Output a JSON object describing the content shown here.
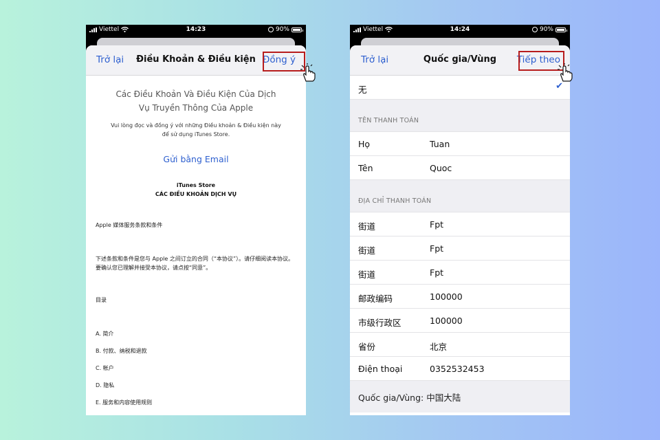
{
  "left_screen": {
    "status": {
      "carrier": "Viettel",
      "time": "14:23",
      "battery": "90%"
    },
    "nav": {
      "back": "Trở lại",
      "title": "Điều Khoản & Điều kiện",
      "action": "Đồng ý"
    },
    "terms_title": "Các Điều Khoản Và Điều Kiện Của Dịch Vụ Truyền Thông Của Apple",
    "terms_subtitle": "Vui lòng đọc và đồng ý với những Điều khoản & Điều kiện này để sử dụng iTunes Store.",
    "email_link": "Gửi bằng Email",
    "store_name": "iTunes Store",
    "store_heading": "CÁC ĐIỀU KHOẢN DỊCH VỤ",
    "paragraphs": [
      "Apple 媒体服务条款和条件",
      "下述条款和条件是您与 Apple 之间订立的合同（“本协议”）。请仔细阅读本协议。要确认您已理解并接受本协议，请点按“同意”。",
      "目录",
      "A. 简介",
      "B. 付款、纳税和退款",
      "C. 帐户",
      "D. 隐私",
      "E. 服务和内容使用规则"
    ]
  },
  "right_screen": {
    "status": {
      "carrier": "Viettel",
      "time": "14:24",
      "battery": "90%"
    },
    "nav": {
      "back": "Trở lại",
      "title": "Quốc gia/Vùng",
      "action": "Tiếp theo"
    },
    "selected_option": "无",
    "billing_name_header": "TÊN THANH TOÁN",
    "name_rows": [
      {
        "label": "Họ",
        "value": "Tuan"
      },
      {
        "label": "Tên",
        "value": "Quoc"
      }
    ],
    "billing_address_header": "ĐỊA CHỈ THANH TOÁN",
    "address_rows": [
      {
        "label": "街道",
        "value": "Fpt"
      },
      {
        "label": "街道",
        "value": "Fpt"
      },
      {
        "label": "街道",
        "value": "Fpt"
      },
      {
        "label": "邮政编码",
        "value": "100000"
      },
      {
        "label": "市级行政区",
        "value": "100000"
      },
      {
        "label": "省份",
        "value": "北京"
      },
      {
        "label": "Điện thoại",
        "value": "0352532453"
      }
    ],
    "footer": "Quốc gia/Vùng: 中国大陆"
  },
  "colors": {
    "link": "#2d5fcf",
    "highlight": "#b71c1c",
    "section_bg": "#efeff3"
  },
  "icons": [
    "signal-bars-icon",
    "wifi-icon",
    "rotation-lock-icon",
    "battery-icon",
    "tap-hand-icon",
    "checkmark-icon"
  ]
}
